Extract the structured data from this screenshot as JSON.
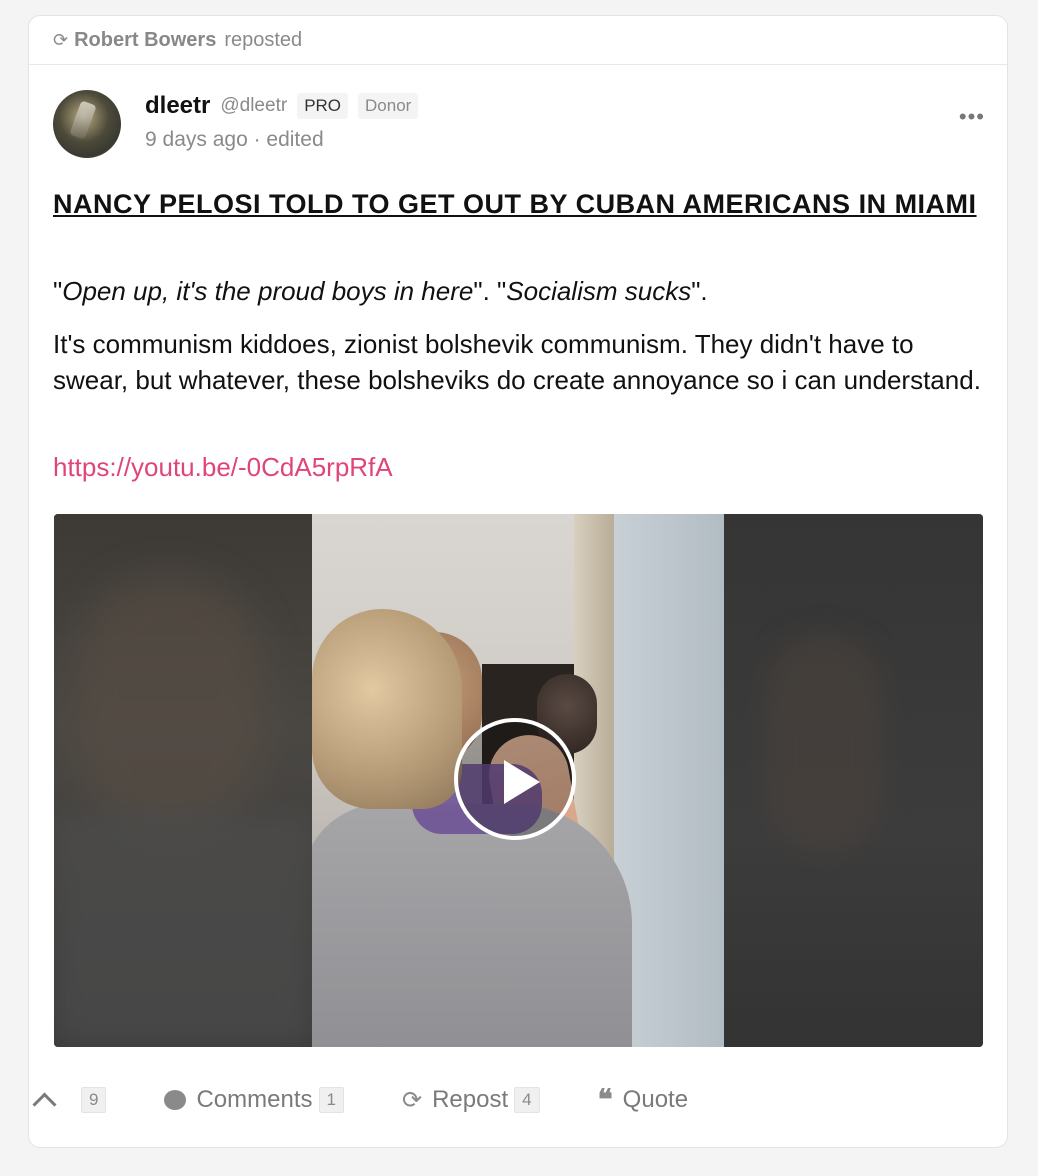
{
  "repost": {
    "icon": "repost-icon",
    "name": "Robert Bowers",
    "action": "reposted"
  },
  "post": {
    "author": {
      "display_name": "dleetr",
      "handle": "@dleetr",
      "badges": [
        "PRO",
        "Donor"
      ],
      "avatar_icon": "user-avatar"
    },
    "meta": "9 days ago · edited",
    "more_icon": "more-options-icon",
    "title": "NANCY PELOSI TOLD TO GET OUT BY CUBAN AMERICANS IN MIAMI",
    "quote_line": {
      "q1_open": " \"",
      "q1": "Open up, it's the proud boys in here",
      "mid": "\". \"",
      "q2": "Socialism sucks",
      "q2_close": "\"."
    },
    "body": " It's communism kiddoes, zionist bolshevik communism. They didn't have to swear, but whatever, these bolsheviks do create annoyance so i can understand.",
    "link": "https://youtu.be/-0CdA5rpRfA",
    "video": {
      "play_icon": "play-icon"
    }
  },
  "actions": {
    "upvote": {
      "icon": "chevron-up-icon",
      "count": "9"
    },
    "comments": {
      "icon": "comment-icon",
      "label": "Comments",
      "count": "1"
    },
    "repost": {
      "icon": "repost-icon",
      "label": "Repost",
      "count": "4"
    },
    "quote": {
      "icon": "quote-icon",
      "label": "Quote"
    }
  },
  "colors": {
    "link": "#e0457a",
    "muted": "#8a8a8a"
  }
}
